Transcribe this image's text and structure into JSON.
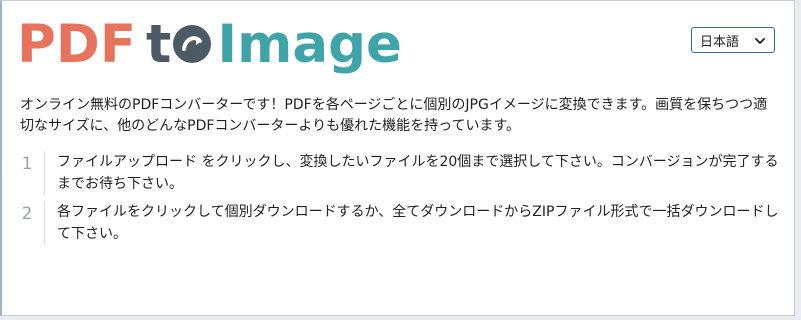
{
  "logo": {
    "part1": "PDF",
    "part2": "t",
    "part3": "Image",
    "colors": {
      "pdf": "#e8735c",
      "to": "#4d5a66",
      "image": "#3fa4a7"
    }
  },
  "language_selector": {
    "value": "日本語",
    "icon": "chevron-down-icon"
  },
  "intro_text": "オンライン無料のPDFコンバーターです！PDFを各ページごとに個別のJPGイメージに変換できます。画質を保ちつつ適切なサイズに、他のどんなPDFコンバーターよりも優れた機能を持っています。",
  "steps": [
    {
      "number": "1",
      "text": "ファイルアップロード をクリックし、変換したいファイルを20個まで選択して下さい。コンバージョンが完了するまでお待ち下さい。"
    },
    {
      "number": "2",
      "text": "各ファイルをクリックして個別ダウンロードするか、全てダウンロードからZIPファイル形式で一括ダウンロードして下さい。"
    }
  ]
}
